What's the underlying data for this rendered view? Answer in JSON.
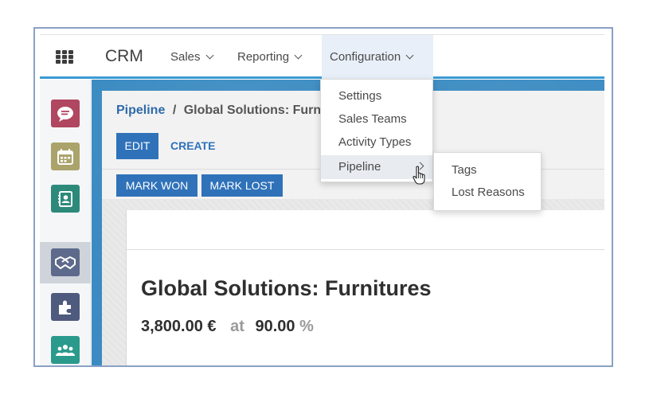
{
  "navbar": {
    "app_name": "CRM",
    "menus": [
      {
        "label": "Sales"
      },
      {
        "label": "Reporting"
      },
      {
        "label": "Configuration"
      }
    ]
  },
  "config_menu": {
    "items": [
      "Settings",
      "Sales Teams",
      "Activity Types",
      "Pipeline"
    ]
  },
  "pipeline_submenu": {
    "items": [
      "Tags",
      "Lost Reasons"
    ]
  },
  "sidebar": {
    "apps": [
      {
        "icon": "discuss-chat-icon",
        "color": "#b0465f"
      },
      {
        "icon": "calendar-icon",
        "color": "#aaa36b"
      },
      {
        "icon": "contacts-icon",
        "color": "#2d8a7b"
      },
      {
        "icon": "crm-handshake-icon",
        "color": "#5d6a8c",
        "selected": true
      },
      {
        "icon": "puzzle-icon",
        "color": "#4e5a7e"
      },
      {
        "icon": "team-icon",
        "color": "#2a9a8c"
      }
    ]
  },
  "breadcrumb": {
    "parent": "Pipeline",
    "separator": "/",
    "current": "Global Solutions: Furn"
  },
  "actions": {
    "edit_label": "EDIT",
    "create_label": "CREATE",
    "mark_won_label": "MARK WON",
    "mark_lost_label": "MARK LOST"
  },
  "record": {
    "title": "Global Solutions: Furnitures",
    "expected_revenue": "3,800.00 €",
    "at_label": "at",
    "probability": "90.00",
    "percent_sign": "%"
  },
  "colors": {
    "accent": "#2f72b9",
    "navbar_border": "#3b9bd4",
    "frame_border": "#8aa1c6"
  }
}
